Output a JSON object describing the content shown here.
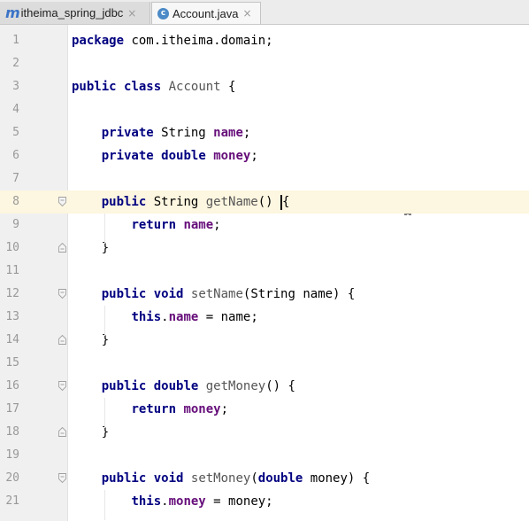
{
  "tabs": [
    {
      "icon": "m",
      "label": "itheima_spring_jdbc",
      "close": "×"
    },
    {
      "icon": "c",
      "label": "Account.java",
      "close": "×"
    }
  ],
  "lines": [
    {
      "num": "1",
      "fold": "",
      "tokens": [
        {
          "t": "package",
          "c": "kw"
        },
        {
          "t": " com.itheima.domain;"
        }
      ]
    },
    {
      "num": "2",
      "fold": "",
      "tokens": []
    },
    {
      "num": "3",
      "fold": "",
      "tokens": [
        {
          "t": "public",
          "c": "kw"
        },
        {
          "t": " "
        },
        {
          "t": "class",
          "c": "kw"
        },
        {
          "t": " "
        },
        {
          "t": "Account",
          "c": "mth"
        },
        {
          "t": " {"
        }
      ]
    },
    {
      "num": "4",
      "fold": "",
      "tokens": []
    },
    {
      "num": "5",
      "fold": "",
      "tokens": [
        {
          "t": "    "
        },
        {
          "t": "private",
          "c": "kw"
        },
        {
          "t": " String "
        },
        {
          "t": "name",
          "c": "fld"
        },
        {
          "t": ";"
        }
      ]
    },
    {
      "num": "6",
      "fold": "",
      "tokens": [
        {
          "t": "    "
        },
        {
          "t": "private",
          "c": "kw"
        },
        {
          "t": " "
        },
        {
          "t": "double",
          "c": "kw"
        },
        {
          "t": " "
        },
        {
          "t": "money",
          "c": "fld"
        },
        {
          "t": ";"
        }
      ]
    },
    {
      "num": "7",
      "fold": "",
      "tokens": []
    },
    {
      "num": "8",
      "fold": "open",
      "current": true,
      "tokens": [
        {
          "t": "    "
        },
        {
          "t": "public",
          "c": "kw"
        },
        {
          "t": " String "
        },
        {
          "t": "getName",
          "c": "mth"
        },
        {
          "t": "() "
        },
        {
          "t": "{",
          "caret": true
        }
      ]
    },
    {
      "num": "9",
      "fold": "",
      "tokens": [
        {
          "t": "        "
        },
        {
          "t": "return",
          "c": "kw"
        },
        {
          "t": " "
        },
        {
          "t": "name",
          "c": "fld"
        },
        {
          "t": ";"
        }
      ]
    },
    {
      "num": "10",
      "fold": "close",
      "tokens": [
        {
          "t": "    }"
        }
      ]
    },
    {
      "num": "11",
      "fold": "",
      "tokens": []
    },
    {
      "num": "12",
      "fold": "open",
      "tokens": [
        {
          "t": "    "
        },
        {
          "t": "public",
          "c": "kw"
        },
        {
          "t": " "
        },
        {
          "t": "void",
          "c": "kw"
        },
        {
          "t": " "
        },
        {
          "t": "setName",
          "c": "mth"
        },
        {
          "t": "(String name) {"
        }
      ]
    },
    {
      "num": "13",
      "fold": "",
      "tokens": [
        {
          "t": "        "
        },
        {
          "t": "this",
          "c": "kw"
        },
        {
          "t": "."
        },
        {
          "t": "name",
          "c": "fld"
        },
        {
          "t": " = name;"
        }
      ]
    },
    {
      "num": "14",
      "fold": "close",
      "tokens": [
        {
          "t": "    }"
        }
      ]
    },
    {
      "num": "15",
      "fold": "",
      "tokens": []
    },
    {
      "num": "16",
      "fold": "open",
      "tokens": [
        {
          "t": "    "
        },
        {
          "t": "public",
          "c": "kw"
        },
        {
          "t": " "
        },
        {
          "t": "double",
          "c": "kw"
        },
        {
          "t": " "
        },
        {
          "t": "getMoney",
          "c": "mth"
        },
        {
          "t": "() {"
        }
      ]
    },
    {
      "num": "17",
      "fold": "",
      "tokens": [
        {
          "t": "        "
        },
        {
          "t": "return",
          "c": "kw"
        },
        {
          "t": " "
        },
        {
          "t": "money",
          "c": "fld"
        },
        {
          "t": ";"
        }
      ]
    },
    {
      "num": "18",
      "fold": "close",
      "tokens": [
        {
          "t": "    }"
        }
      ]
    },
    {
      "num": "19",
      "fold": "",
      "tokens": []
    },
    {
      "num": "20",
      "fold": "open",
      "tokens": [
        {
          "t": "    "
        },
        {
          "t": "public",
          "c": "kw"
        },
        {
          "t": " "
        },
        {
          "t": "void",
          "c": "kw"
        },
        {
          "t": " "
        },
        {
          "t": "setMoney",
          "c": "mth"
        },
        {
          "t": "("
        },
        {
          "t": "double",
          "c": "kw"
        },
        {
          "t": " money) {"
        }
      ]
    },
    {
      "num": "21",
      "fold": "",
      "tokens": [
        {
          "t": "        "
        },
        {
          "t": "this",
          "c": "kw"
        },
        {
          "t": "."
        },
        {
          "t": "money",
          "c": "fld"
        },
        {
          "t": " = money;"
        }
      ]
    }
  ],
  "colors": {
    "keyword": "#000080",
    "field": "#660e7a",
    "current_line": "#fdf6e0"
  }
}
